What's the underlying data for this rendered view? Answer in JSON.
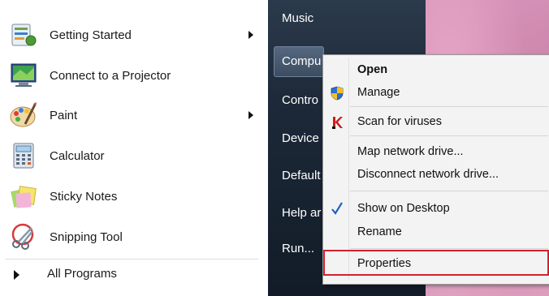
{
  "programs": [
    {
      "label": "Getting Started",
      "icon": "getting-started-icon",
      "has_submenu": true
    },
    {
      "label": "Connect to a Projector",
      "icon": "projector-icon",
      "has_submenu": false
    },
    {
      "label": "Paint",
      "icon": "paint-icon",
      "has_submenu": true
    },
    {
      "label": "Calculator",
      "icon": "calculator-icon",
      "has_submenu": false
    },
    {
      "label": "Sticky Notes",
      "icon": "sticky-notes-icon",
      "has_submenu": false
    },
    {
      "label": "Snipping Tool",
      "icon": "snipping-tool-icon",
      "has_submenu": false
    }
  ],
  "all_programs_label": "All Programs",
  "right_pane": {
    "items": [
      "Music",
      "Compu",
      "Contro",
      "Device",
      "Default",
      "Help ar",
      "Run..."
    ]
  },
  "context_menu": {
    "items": [
      {
        "label": "Open",
        "bold": true,
        "icon": ""
      },
      {
        "label": "Manage",
        "bold": false,
        "icon": "uac-shield-icon"
      },
      {
        "label": "Scan for viruses",
        "bold": false,
        "icon": "antivirus-k-icon"
      },
      {
        "label": "Map network drive...",
        "bold": false,
        "icon": ""
      },
      {
        "label": "Disconnect network drive...",
        "bold": false,
        "icon": ""
      },
      {
        "label": "Show on Desktop",
        "bold": false,
        "icon": "checkmark-icon",
        "checked": true
      },
      {
        "label": "Rename",
        "bold": false,
        "icon": ""
      },
      {
        "label": "Properties",
        "bold": false,
        "icon": "",
        "highlighted": true
      }
    ]
  },
  "colors": {
    "highlight_border": "#d3202d",
    "dark_pane": "#1d2938",
    "check": "#1f5fc8"
  }
}
